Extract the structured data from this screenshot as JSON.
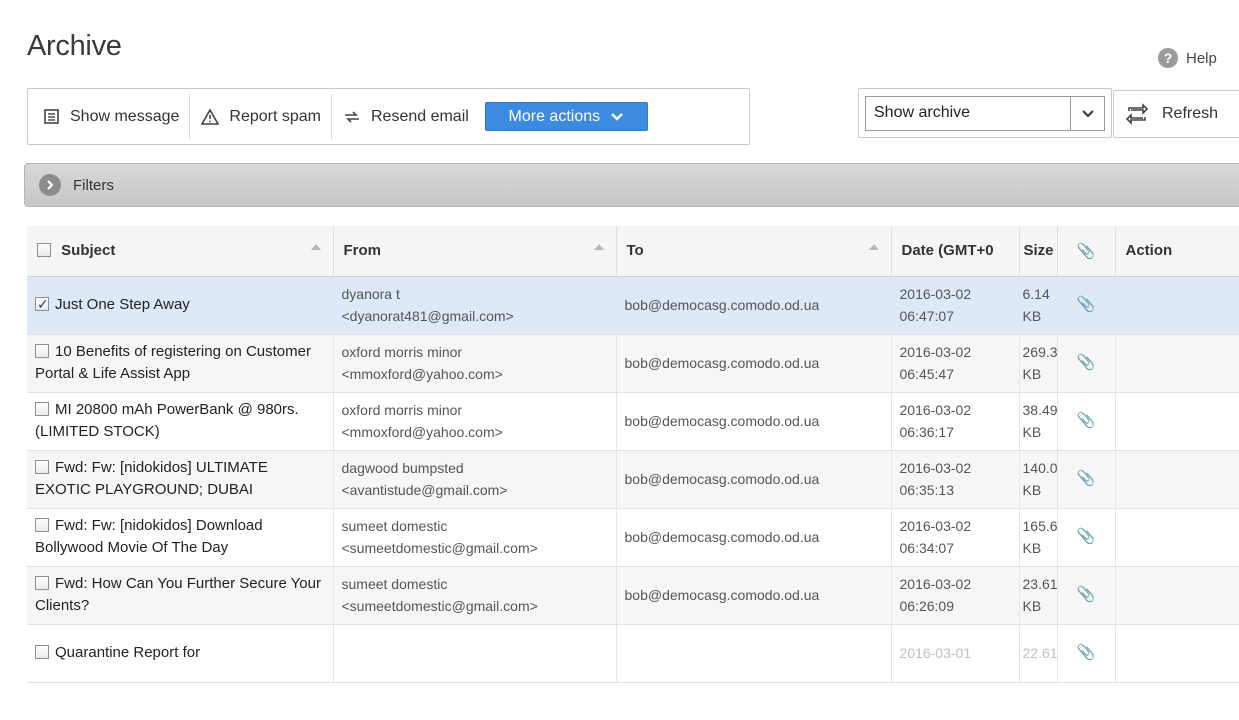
{
  "header": {
    "title": "Archive",
    "help_label": "Help",
    "help_icon": "help-icon"
  },
  "toolbar": {
    "show_message_label": "Show message",
    "report_spam_label": "Report spam",
    "resend_email_label": "Resend email",
    "more_actions_label": "More actions",
    "accent_color": "#3d8be0"
  },
  "archive_select": {
    "selected": "Show archive"
  },
  "refresh_label": "Refresh",
  "filters": {
    "label": "Filters"
  },
  "table": {
    "columns": {
      "subject": "Subject",
      "from": "From",
      "to": "To",
      "date": "Date (GMT+0",
      "size": "Size",
      "action": "Action"
    },
    "rows": [
      {
        "checked": true,
        "subject": "Just One Step Away",
        "from_name": "dyanora t",
        "from_email": "<dyanorat481@gmail.com>",
        "to": "bob@democasg.comodo.od.ua",
        "date": "2016-03-02",
        "time": "06:47:07",
        "size": "6.14",
        "size_unit": "KB"
      },
      {
        "checked": false,
        "subject": "10 Benefits of registering on Customer Portal & Life Assist App",
        "from_name": "oxford morris minor",
        "from_email": "<mmoxford@yahoo.com>",
        "to": "bob@democasg.comodo.od.ua",
        "date": "2016-03-02",
        "time": "06:45:47",
        "size": "269.3!",
        "size_unit": "KB"
      },
      {
        "checked": false,
        "subject": "MI 20800 mAh PowerBank @ 980rs. (LIMITED STOCK)",
        "from_name": "oxford morris minor",
        "from_email": "<mmoxford@yahoo.com>",
        "to": "bob@democasg.comodo.od.ua",
        "date": "2016-03-02",
        "time": "06:36:17",
        "size": "38.49",
        "size_unit": "KB"
      },
      {
        "checked": false,
        "subject": "Fwd: Fw: [nidokidos] ULTIMATE EXOTIC PLAYGROUND; DUBAI",
        "from_name": "dagwood bumpsted",
        "from_email": "<avantistude@gmail.com>",
        "to": "bob@democasg.comodo.od.ua",
        "date": "2016-03-02",
        "time": "06:35:13",
        "size": "140.0:",
        "size_unit": "KB"
      },
      {
        "checked": false,
        "subject": "Fwd: Fw: [nidokidos] Download Bollywood Movie Of The Day",
        "from_name": "sumeet domestic",
        "from_email": "<sumeetdomestic@gmail.com>",
        "to": "bob@democasg.comodo.od.ua",
        "date": "2016-03-02",
        "time": "06:34:07",
        "size": "165.6'",
        "size_unit": "KB"
      },
      {
        "checked": false,
        "subject": "Fwd: How Can You Further Secure Your Clients?",
        "from_name": "sumeet domestic",
        "from_email": "<sumeetdomestic@gmail.com>",
        "to": "bob@democasg.comodo.od.ua",
        "date": "2016-03-02",
        "time": "06:26:09",
        "size": "23.61",
        "size_unit": "KB"
      },
      {
        "checked": false,
        "subject": "Quarantine Report for",
        "date": "2016-03-01",
        "size": "22.61"
      }
    ]
  }
}
